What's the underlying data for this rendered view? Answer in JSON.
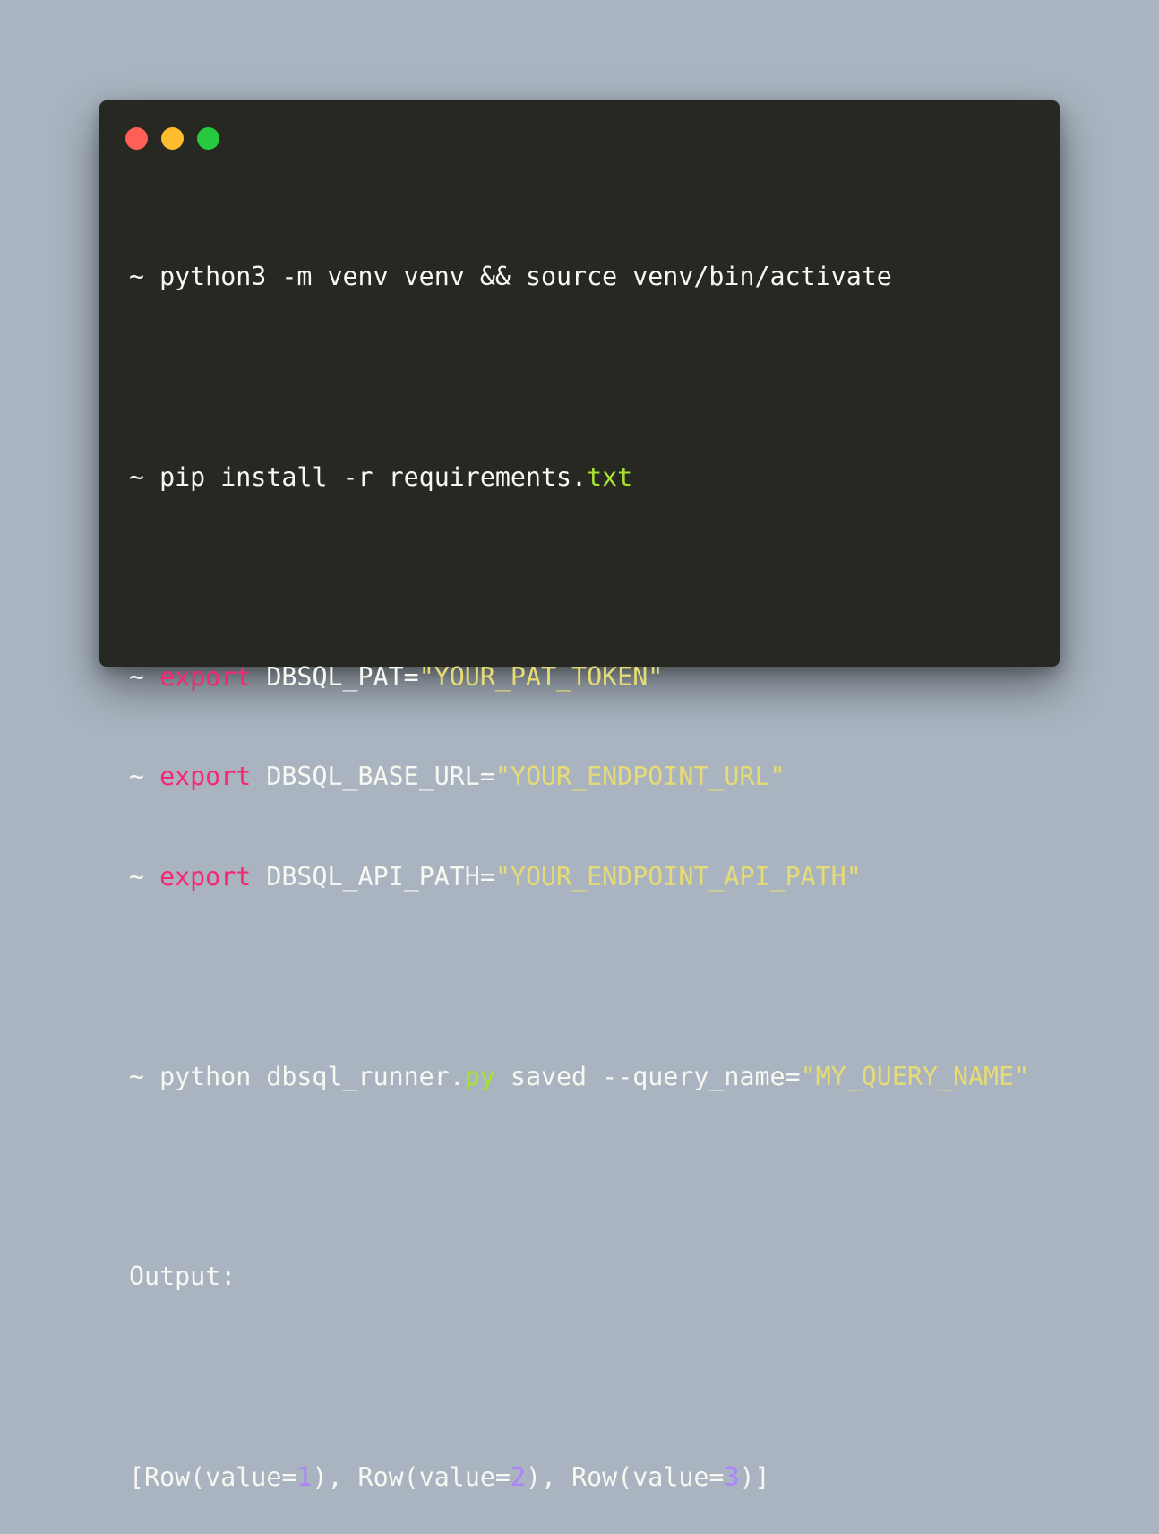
{
  "window": {
    "controls": {
      "close_color": "#ff5f56",
      "minimize_color": "#ffbd2e",
      "maximize_color": "#27c93f"
    }
  },
  "colors": {
    "background": "#a9b4c0",
    "editor_bg": "#272822",
    "text": "#f8f8f2",
    "keyword": "#f92672",
    "string": "#e6db74",
    "extension": "#a6e22e",
    "number": "#ae81ff"
  },
  "code": {
    "line1": {
      "text": "~ python3 -m venv venv && source venv/bin/activate"
    },
    "line2": {
      "prefix": "~ pip install -r requirements.",
      "ext": "txt"
    },
    "line3": {
      "prompt": "~ ",
      "keyword": "export",
      "assign": " DBSQL_PAT=",
      "value": "\"YOUR_PAT_TOKEN\""
    },
    "line4": {
      "prompt": "~ ",
      "keyword": "export",
      "assign": " DBSQL_BASE_URL=",
      "value": "\"YOUR_ENDPOINT_URL\""
    },
    "line5": {
      "prompt": "~ ",
      "keyword": "export",
      "assign": " DBSQL_API_PATH=",
      "value": "\"YOUR_ENDPOINT_API_PATH\""
    },
    "line6": {
      "prefix": "~ python dbsql_runner.",
      "ext": "py",
      "middle": " saved --query_name=",
      "value": "\"MY_QUERY_NAME\""
    },
    "output_label": "Output:",
    "output": {
      "p1": "[Row(value=",
      "n1": "1",
      "p2": "), Row(value=",
      "n2": "2",
      "p3": "), Row(value=",
      "n3": "3",
      "p4": ")]"
    }
  }
}
